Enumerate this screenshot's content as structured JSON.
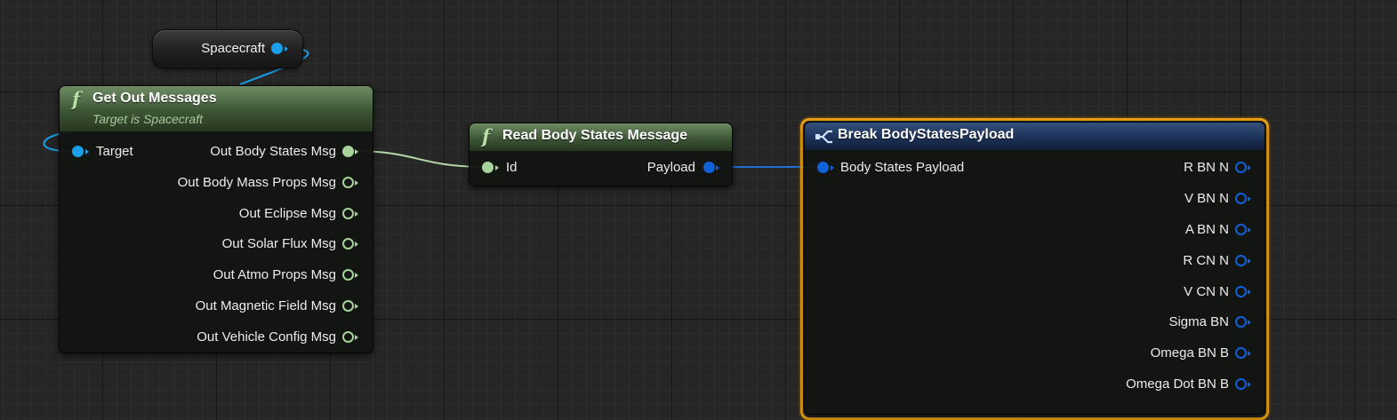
{
  "variable_node": {
    "label": "Spacecraft",
    "pin_color": "#1aa0e8"
  },
  "get_out_messages": {
    "title": "Get Out Messages",
    "subtitle": "Target is Spacecraft",
    "input_label": "Target",
    "outputs": [
      "Out Body States Msg",
      "Out Body Mass Props Msg",
      "Out Eclipse Msg",
      "Out Solar Flux Msg",
      "Out Atmo Props Msg",
      "Out Magnetic Field Msg",
      "Out Vehicle Config Msg"
    ],
    "header_color": "#3c5635"
  },
  "read_body_states": {
    "title": "Read Body States Message",
    "input_label": "Id",
    "output_label": "Payload"
  },
  "break_payload": {
    "title": "Break BodyStatesPayload",
    "input_label": "Body States Payload",
    "outputs": [
      "R BN N",
      "V BN N",
      "A BN N",
      "R CN N",
      "V CN N",
      "Sigma BN",
      "Omega BN B",
      "Omega Dot BN B"
    ],
    "highlight_color": "#f0a516",
    "header_color": "#1c3258"
  },
  "colors": {
    "object_pin": "#1aa0e8",
    "struct_pin": "#1060d8",
    "message_pin": "#a6d49a",
    "wire_message": "#b4d8a8",
    "wire_struct": "#1d6fd0",
    "wire_object": "#1aa0e8"
  },
  "icons": {
    "function": "function-f-icon",
    "break_struct": "break-struct-icon"
  }
}
